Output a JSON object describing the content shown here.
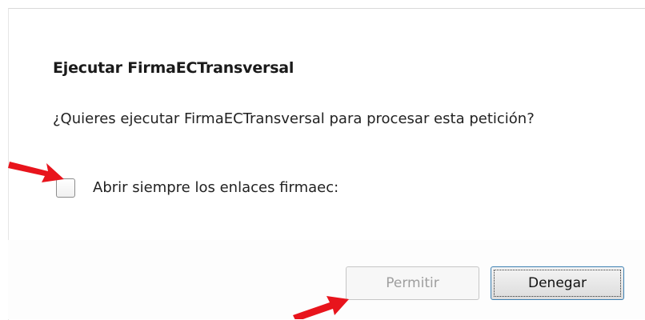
{
  "dialog": {
    "title": "Ejecutar FirmaECTransversal",
    "message": "¿Quieres ejecutar FirmaECTransversal para procesar esta petición?",
    "checkbox_label": "Abrir siempre los enlaces firmaec:",
    "checkbox_checked": false,
    "permit_button": "Permitir",
    "permit_enabled": false,
    "deny_button": "Denegar"
  },
  "annotations": {
    "arrow_color": "#e8141c",
    "arrows": [
      "red-arrow-icon",
      "red-arrow-icon"
    ]
  }
}
